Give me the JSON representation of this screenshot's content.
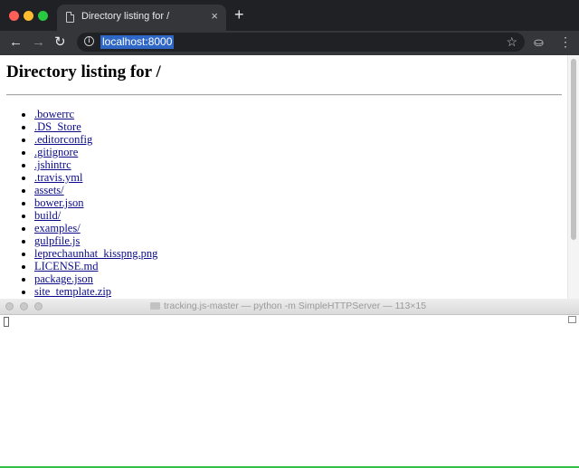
{
  "browser": {
    "tab": {
      "title": "Directory listing for /",
      "close_glyph": "×"
    },
    "new_tab_glyph": "+",
    "toolbar": {
      "back_glyph": "←",
      "forward_glyph": "→",
      "reload_glyph": "↻",
      "info_glyph": "i",
      "url": "localhost:8000",
      "star_glyph": "☆",
      "ext_glyph": "⛀",
      "menu_glyph": "⋮"
    },
    "icons": [
      "document-icon",
      "close-icon",
      "plus-icon",
      "back-arrow-icon",
      "forward-arrow-icon",
      "reload-icon",
      "info-icon",
      "star-icon",
      "extension-icon",
      "menu-icon"
    ]
  },
  "page": {
    "heading": "Directory listing for /",
    "files": [
      ".bowerrc",
      ".DS_Store",
      ".editorconfig",
      ".gitignore",
      ".jshintrc",
      ".travis.yml",
      "assets/",
      "bower.json",
      "build/",
      "examples/",
      "gulpfile.js",
      "leprechaunhat_kisspng.png",
      "LICENSE.md",
      "package.json",
      "site_template.zip"
    ]
  },
  "terminal": {
    "title": "tracking.js-master — python -m SimpleHTTPServer — 113×15"
  },
  "colors": {
    "tabbar": "#202124",
    "toolbar": "#35363a",
    "url_highlight": "#2f67c6",
    "link": "#0b0b8a",
    "terminal_titlebar": "#e4e4e4"
  }
}
